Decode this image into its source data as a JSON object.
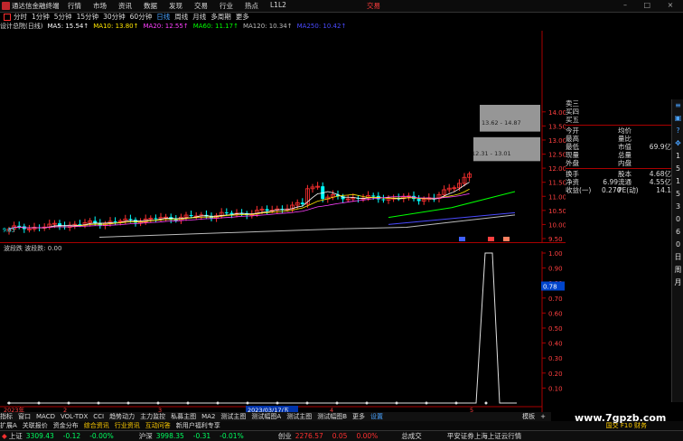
{
  "menubar": {
    "app_name": "通达信金融终端",
    "menu": [
      "行情",
      "市场",
      "资讯",
      "数据",
      "发现",
      "交易",
      "行业",
      "热点",
      "L1L2"
    ],
    "trade_button": "交易",
    "window_buttons": "– □ ×"
  },
  "periods": {
    "items": [
      "分时",
      "1分钟",
      "5分钟",
      "15分钟",
      "30分钟",
      "60分钟",
      "日线",
      "周线",
      "月线",
      "多周期",
      "更多"
    ],
    "active": "日线"
  },
  "ma_legend": {
    "title": "设计总院(日线)",
    "items": [
      {
        "label": "MA5: 15.54↑",
        "color": "#ffffff"
      },
      {
        "label": "MA10: 13.80↑",
        "color": "#ffe600"
      },
      {
        "label": "MA20: 12.55↑",
        "color": "#ff40ff"
      },
      {
        "label": "MA60: 11.17↑",
        "color": "#00ff00"
      },
      {
        "label": "MA120: 10.34↑",
        "color": "#bbbbbb"
      },
      {
        "label": "MA250: 10.42↑",
        "color": "#4a4aff"
      }
    ]
  },
  "price_axis": [
    "14.00",
    "13.50",
    "13.00",
    "12.50",
    "12.00",
    "11.50",
    "11.00",
    "10.50",
    "10.00",
    "9.50"
  ],
  "zone_labels": {
    "upper": "13.62 - 14.87",
    "lower": "12.31 - 13.01"
  },
  "price_left_label": "9.83",
  "indicator": {
    "legend": "波段跌 波段跌: 0.00",
    "axis": [
      "1.00",
      "0.90",
      "0.80",
      "0.70",
      "0.60",
      "0.50",
      "0.40",
      "0.30",
      "0.20",
      "0.10"
    ],
    "current_value": "0.78"
  },
  "time_axis": {
    "start": "2023年",
    "highlight": "2023/03/17/五",
    "markers": [
      "2",
      "3",
      "4",
      "5"
    ]
  },
  "bottom_tabs": [
    "指标",
    "窗口",
    "MACD",
    "VOL-TDX",
    "CCI",
    "趋势动力",
    "主力监控",
    "私募主图",
    "MA2",
    "测试主图",
    "测试幅图A",
    "测试主图",
    "测试幅图B",
    "更多",
    "设置"
  ],
  "bottom_tabs_right": [
    "模板",
    "+"
  ],
  "ext_tabs": [
    {
      "label": "扩展A",
      "color": "#dddddd"
    },
    {
      "label": "关联报价",
      "color": "#dddddd"
    },
    {
      "label": "资金分布",
      "color": "#dddddd"
    },
    {
      "label": "综合资讯",
      "color": "#ffcc00"
    },
    {
      "label": "行业资讯",
      "color": "#ffcc00"
    },
    {
      "label": "互动问答",
      "color": "#ffcc00"
    },
    {
      "label": "新用户福利专享",
      "color": "#dddddd"
    }
  ],
  "ext_tabs_right": "国交 F10 财务",
  "right_panel": {
    "order_book": [
      "卖三",
      "买四",
      "买五"
    ],
    "rows": [
      {
        "l1": "今开",
        "v1": "",
        "l2": "均价",
        "v2": ""
      },
      {
        "l1": "最高",
        "v1": "",
        "l2": "量比",
        "v2": ""
      },
      {
        "l1": "最低",
        "v1": "",
        "l2": "市值",
        "v2": "69.9亿"
      },
      {
        "l1": "现量",
        "v1": "",
        "l2": "总量",
        "v2": ""
      },
      {
        "l1": "外盘",
        "v1": "",
        "l2": "内盘",
        "v2": ""
      },
      {
        "l1": "换手",
        "v1": "",
        "l2": "股本",
        "v2": "4.68亿"
      },
      {
        "l1": "净资",
        "v1": "6.99",
        "l2": "流通",
        "v2": "4.55亿"
      },
      {
        "l1": "收益(一)",
        "v1": "0.270",
        "l2": "PE(动)",
        "v2": "14.1"
      }
    ]
  },
  "sidebar_icons": [
    "≡",
    "▣",
    "?",
    "✥",
    "1",
    "5",
    "1",
    "5",
    "3",
    "0",
    "6",
    "0",
    "日",
    "周",
    "月"
  ],
  "status": {
    "sh_label": "上证",
    "sh_value": "3309.43",
    "sh_change": "-0.12",
    "sh_pct": "-0.00%",
    "sz_label": "沪深",
    "sz_value": "3998.35",
    "sz_change": "-0.31",
    "sz_pct": "-0.01%",
    "cy_label": "创业",
    "cy_value": "2276.57",
    "cy_change": "0.05",
    "cy_pct": "0.00%",
    "trade_label": "总成交",
    "broker": "平安证券上海上证云行情"
  },
  "watermark": "www.7gpzb.com",
  "colors": {
    "up": "#ff3030",
    "down": "#00ffff",
    "ma5": "#ffffff",
    "ma10": "#ffe600",
    "ma20": "#ff40ff",
    "ma60": "#00ff00",
    "ma120": "#bbbbbb",
    "ma250": "#4a4aff"
  }
}
